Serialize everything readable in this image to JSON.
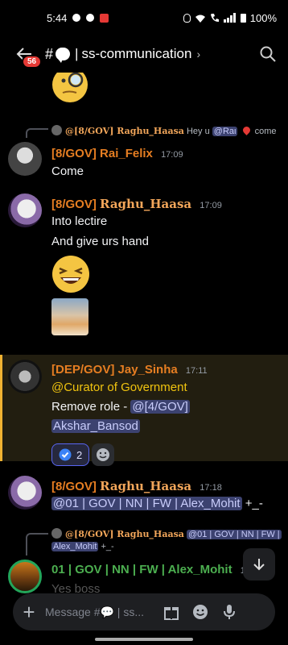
{
  "status_bar": {
    "time": "5:44",
    "battery": "100%"
  },
  "header": {
    "unread_count": "56",
    "channel_name": "ss-communication"
  },
  "messages": [
    {
      "reply": {
        "author": "@[8/GOV] Raghu_Haasa",
        "text": "Hey u",
        "mention": "@Raι",
        "tail": "come"
      },
      "author_tag": "[8/GOV]",
      "author_name": "Rai_Felix",
      "time": "17:09",
      "lines": [
        "Come"
      ]
    },
    {
      "author_tag": "[8/GOV]",
      "author_name": "Raghu_Haasa",
      "time": "17:09",
      "lines": [
        "Into lectire",
        "And give urs hand"
      ]
    },
    {
      "author_tag": "[DEP/GOV]",
      "author_name": "Jay_Sinha",
      "time": "17:11",
      "role_mention": "@Curator of Government",
      "line_prefix": "Remove role - ",
      "user_mention_1": "@[4/GOV]",
      "user_mention_2": "Akshar_Bansod",
      "reaction_count": "2"
    },
    {
      "author_tag": "[8/GOV]",
      "author_name": "Raghu_Haasa",
      "time": "17:18",
      "mention": "@01 | GOV | NN | FW | Alex_Mohit",
      "tail": " +_-"
    },
    {
      "reply": {
        "author": "@[8/GOV] Raghu_Haasa",
        "mention1": "@01 | GOV | NN | FW |",
        "mention2": "Alex_Mohit",
        "tail": " +_-"
      },
      "author_name": "01 | GOV | NN | FW | Alex_Mohit",
      "time": "17:",
      "lines": [
        "Yes boss"
      ]
    }
  ],
  "composer": {
    "placeholder": "Message #💬 | ss..."
  },
  "colors": {
    "accent": "#5865f2",
    "gov_orange": "#e67e22",
    "highlight": "#f0b232"
  }
}
